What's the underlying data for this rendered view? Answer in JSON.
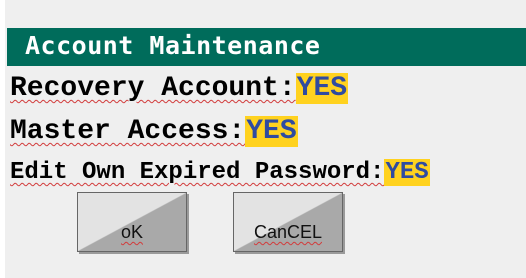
{
  "header": {
    "title": "Account Maintenance"
  },
  "settings": [
    {
      "label": "Recovery Account:",
      "value": "YES"
    },
    {
      "label": "Master Access:",
      "value": "YES"
    },
    {
      "label": "Edit Own Expired Password:",
      "value": "YES"
    }
  ],
  "buttons": {
    "ok_label": "oK",
    "cancel_label": "CanCEL"
  },
  "colors": {
    "header_bg": "#006c5b",
    "value_highlight": "#ffd21f",
    "value_text": "#2f4ba1",
    "panel_bg": "#efefef"
  }
}
